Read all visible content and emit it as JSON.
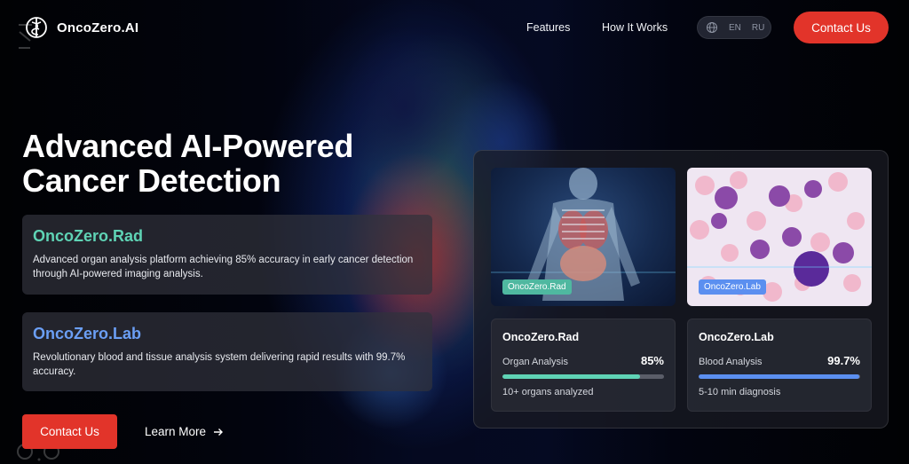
{
  "brand": {
    "name": "OncoZero.AI"
  },
  "nav": {
    "links": [
      "Features",
      "How It Works"
    ],
    "languages": [
      "EN",
      "RU"
    ],
    "cta_label": "Contact Us"
  },
  "hero": {
    "title": "Advanced AI-Powered Cancer Detection",
    "products": [
      {
        "name": "OncoZero.Rad",
        "description": "Advanced organ analysis platform achieving 85% accuracy in early cancer detection through AI-powered imaging analysis.",
        "color": "#5fd3b5"
      },
      {
        "name": "OncoZero.Lab",
        "description": "Revolutionary blood and tissue analysis system delivering rapid results with 99.7% accuracy.",
        "color": "#6b9ff5"
      }
    ],
    "cta_label": "Contact Us",
    "learn_more_label": "Learn More"
  },
  "panel": {
    "images": [
      {
        "tag": "OncoZero.Rad",
        "tag_color": "#4fb8a0"
      },
      {
        "tag": "OncoZero.Lab",
        "tag_color": "#5b8ff0"
      }
    ],
    "stats": [
      {
        "title": "OncoZero.Rad",
        "metric": "Organ Analysis",
        "value": "85%",
        "progress": 0.85,
        "bar_color": "#5fd3b5",
        "note": "10+ organs analyzed"
      },
      {
        "title": "OncoZero.Lab",
        "metric": "Blood Analysis",
        "value": "99.7%",
        "progress": 0.997,
        "bar_color": "#5b8ff0",
        "note": "5-10 min diagnosis"
      }
    ]
  },
  "colors": {
    "accent_red": "#e2342a"
  },
  "icons": [
    "logo-icon",
    "globe-icon",
    "arrow-right-icon"
  ]
}
